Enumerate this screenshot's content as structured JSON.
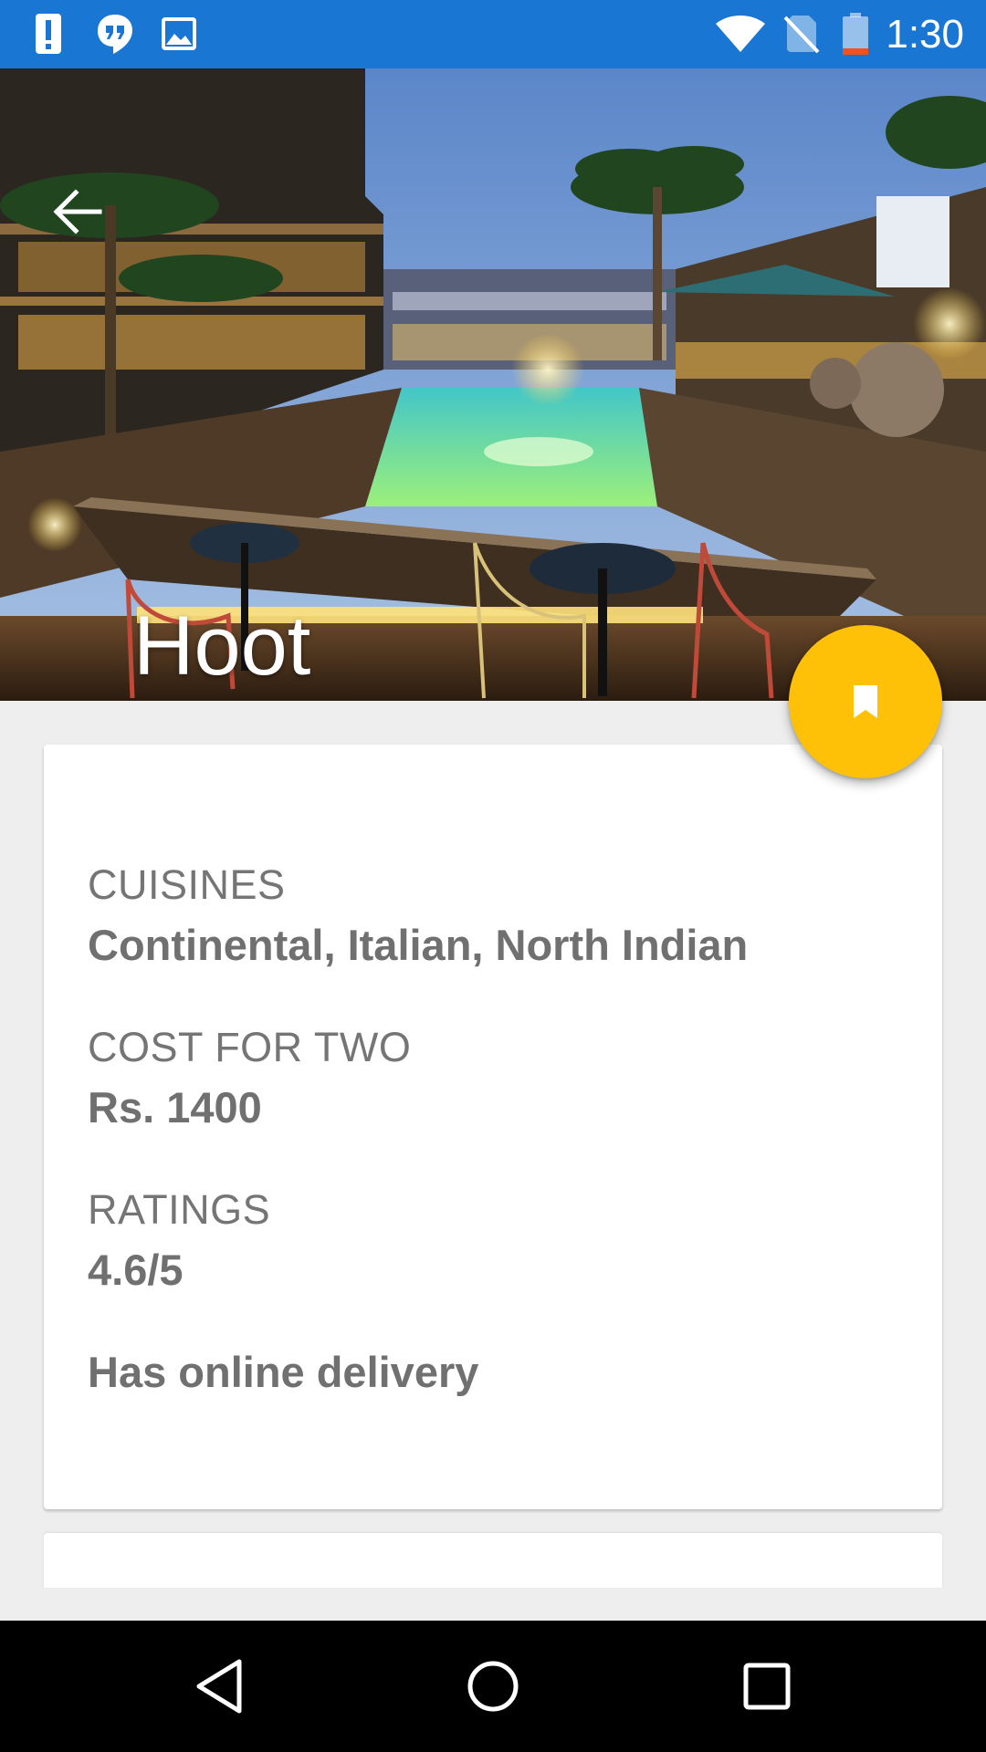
{
  "status_bar": {
    "time": "1:30",
    "icons": [
      "alert-notification-icon",
      "hangouts-icon",
      "image-notification-icon",
      "wifi-icon",
      "no-sim-icon",
      "battery-low-icon"
    ],
    "background_color": "#1976d2"
  },
  "header": {
    "title": "Hoot",
    "back_icon": "arrow-back-icon"
  },
  "fab": {
    "icon": "bookmark-icon",
    "color": "#ffc107"
  },
  "details": {
    "cuisines_label": "CUISINES",
    "cuisines_value": "Continental, Italian, North Indian",
    "cost_label": "COST FOR TWO",
    "cost_value": "Rs. 1400",
    "ratings_label": "RATINGS",
    "ratings_value": "4.6/5",
    "delivery_text": "Has online delivery"
  },
  "nav_bar": {
    "buttons": [
      "back-nav-icon",
      "home-nav-icon",
      "recents-nav-icon"
    ]
  }
}
